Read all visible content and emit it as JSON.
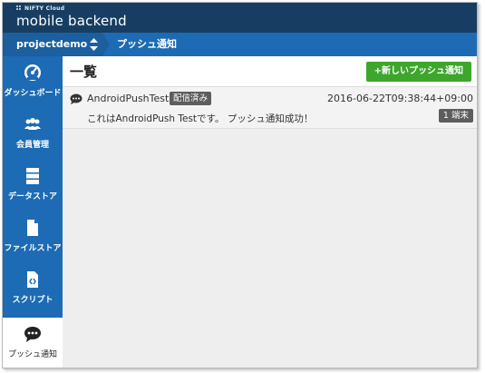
{
  "header": {
    "brand_small": "NIFTY Cloud",
    "brand_main": "mobile backend"
  },
  "breadcrumb": {
    "project": "projectdemo",
    "current": "プッシュ通知"
  },
  "sidebar": {
    "items": [
      {
        "label": "ダッシュボード",
        "icon": "dashboard-icon",
        "active": false
      },
      {
        "label": "会員管理",
        "icon": "users-icon",
        "active": false
      },
      {
        "label": "データストア",
        "icon": "database-icon",
        "active": false
      },
      {
        "label": "ファイルストア",
        "icon": "file-icon",
        "active": false
      },
      {
        "label": "スクリプト",
        "icon": "script-icon",
        "active": false
      },
      {
        "label": "プッシュ通知",
        "icon": "chat-bubble-icon",
        "active": true
      }
    ]
  },
  "main": {
    "title": "一覧",
    "new_button": "+新しいプッシュ通知",
    "messages": [
      {
        "title": "AndroidPushTest",
        "status": "配信済み",
        "timestamp": "2016-06-22T09:38:44+09:00",
        "body": "これはAndroidPush Testです。 プッシュ通知成功！",
        "devices": "1 端末"
      }
    ]
  },
  "colors": {
    "topbar": "#173e62",
    "accent": "#1c6bb4",
    "button_green": "#3ea52d",
    "badge_gray": "#5d5d5d"
  }
}
